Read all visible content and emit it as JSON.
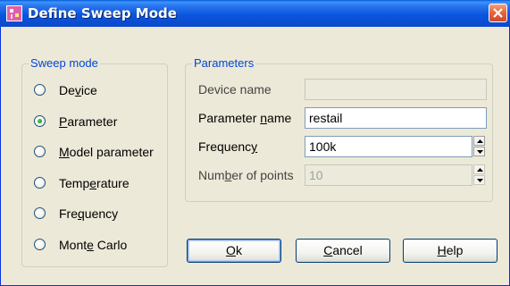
{
  "window": {
    "title": "Define Sweep Mode",
    "close_icon": "close-icon"
  },
  "sweep_mode": {
    "legend": "Sweep mode",
    "options": [
      {
        "pre": "De",
        "key": "v",
        "post": "ice",
        "selected": false
      },
      {
        "pre": "",
        "key": "P",
        "post": "arameter",
        "selected": true
      },
      {
        "pre": "",
        "key": "M",
        "post": "odel parameter",
        "selected": false
      },
      {
        "pre": "Temp",
        "key": "e",
        "post": "rature",
        "selected": false
      },
      {
        "pre": "Fre",
        "key": "q",
        "post": "uency",
        "selected": false
      },
      {
        "pre": "Mont",
        "key": "e",
        "post": " Carlo",
        "selected": false
      }
    ]
  },
  "parameters": {
    "legend": "Parameters",
    "device_name": {
      "label": "Device name",
      "value": ""
    },
    "parameter_name": {
      "pre": "Parameter ",
      "key": "n",
      "post": "ame",
      "value": "restail"
    },
    "frequency": {
      "pre": "Frequenc",
      "key": "y",
      "post": "",
      "value": "100k"
    },
    "num_points": {
      "pre": "Num",
      "key": "b",
      "post": "er of points",
      "value": "10"
    }
  },
  "buttons": {
    "ok": {
      "key": "O",
      "post": "k"
    },
    "cancel": {
      "key": "C",
      "post": "ancel"
    },
    "help": {
      "key": "H",
      "post": "elp"
    }
  },
  "colors": {
    "title_bar": "#0b55de",
    "group_legend": "#0046d5",
    "dialog_bg": "#ece9d8"
  }
}
